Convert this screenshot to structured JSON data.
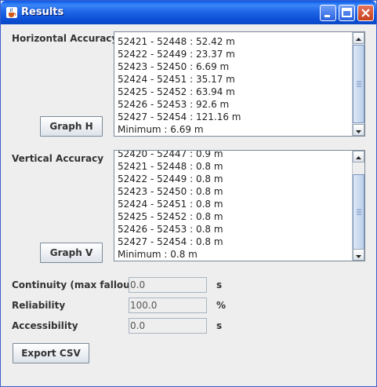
{
  "window": {
    "title": "Results"
  },
  "horizontal": {
    "label": "Horizontal Accuracy",
    "button": "Graph H",
    "items": [
      "52421 - 52448 : 52.42 m",
      "52422 - 52449 : 23.37 m",
      "52423 - 52450 : 6.69 m",
      "52424 - 52451 : 35.17 m",
      "52425 - 52452 : 63.94 m",
      "52426 - 52453 : 92.6 m",
      "52427 - 52454 : 121.16 m",
      "Minimum : 6.69 m"
    ]
  },
  "vertical": {
    "label": "Vertical Accuracy",
    "button": "Graph V",
    "items": [
      "52420 - 52447 : 0.9 m",
      "52421 - 52448 : 0.8 m",
      "52422 - 52449 : 0.8 m",
      "52423 - 52450 : 0.8 m",
      "52424 - 52451 : 0.8 m",
      "52425 - 52452 : 0.8 m",
      "52426 - 52453 : 0.8 m",
      "52427 - 52454 : 0.8 m",
      "Minimum : 0.8 m"
    ]
  },
  "metrics": {
    "continuity": {
      "label": "Continuity (max fallout)",
      "value": "0.0",
      "unit": "s"
    },
    "reliability": {
      "label": "Reliability",
      "value": "100.0",
      "unit": "%"
    },
    "accessibility": {
      "label": "Accessibility",
      "value": "0.0",
      "unit": "s"
    }
  },
  "export_button": "Export CSV"
}
